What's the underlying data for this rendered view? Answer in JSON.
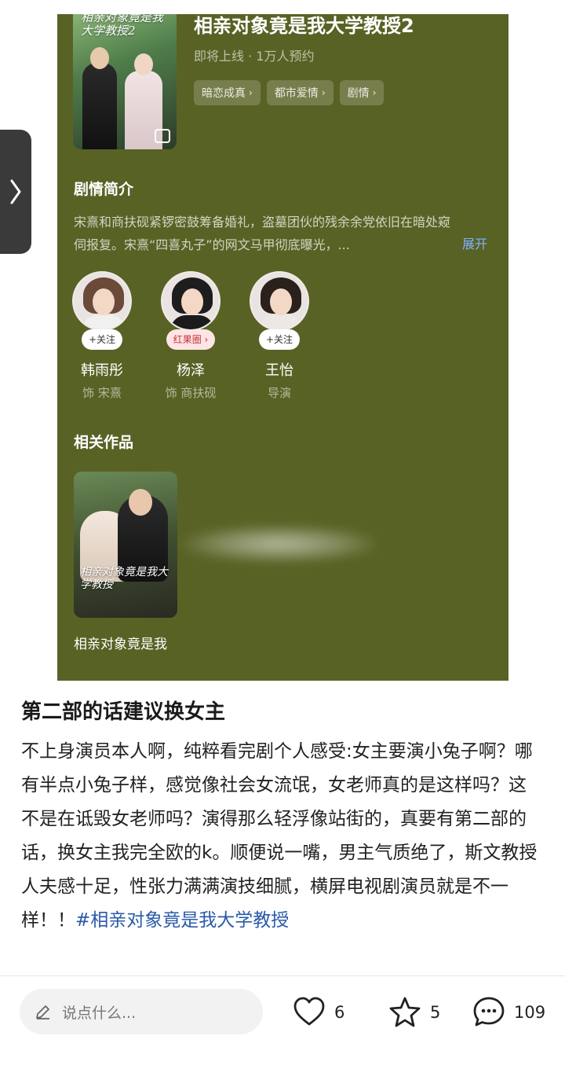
{
  "embedded_card": {
    "drama_title": "相亲对象竟是我大学教授2",
    "status": "即将上线 · 1万人预约",
    "tags": [
      "暗恋成真",
      "都市爱情",
      "剧情"
    ],
    "synopsis_heading": "剧情简介",
    "synopsis": "宋熹和商扶砚紧锣密鼓筹备婚礼，盗墓团伙的残余余党依旧在暗处窥伺报复。宋熹“四喜丸子”的网文马甲彻底曝光，...",
    "expand_label": "展开",
    "poster_title_art": "相亲对象竟是我大学教授2",
    "cast": [
      {
        "name": "韩雨彤",
        "role": "饰 宋熹",
        "pill": "+关注"
      },
      {
        "name": "杨泽",
        "role": "饰 商扶砚",
        "pill": "红果圈 ›"
      },
      {
        "name": "王怡",
        "role": "导演",
        "pill": "+关注"
      }
    ],
    "related_heading": "相关作品",
    "related_title": "相亲对象竟是我",
    "related_poster_art": "相亲对象竟是我大学教授"
  },
  "post": {
    "title": "第二部的话建议换女主",
    "body": "不上身演员本人啊，纯粹看完剧个人感受:女主要演小兔子啊？哪有半点小兔子样，感觉像社会女流氓，女老师真的是这样吗？这不是在诋毁女老师吗？演得那么轻浮像站街的，真要有第二部的话，换女主我完全欧的k。顺便说一嘴，男主气质绝了，斯文教授人夫感十足，性张力满满演技细腻，横屏电视剧演员就是不一样！！",
    "hashtag": "#相亲对象竟是我大学教授"
  },
  "bottom_bar": {
    "comment_placeholder": "说点什么...",
    "likes": "6",
    "favorites": "5",
    "comments": "109"
  },
  "icons": {
    "side_handle": "chevron-right-icon",
    "comment_input": "pencil-icon",
    "like": "heart-icon",
    "favorite": "star-icon",
    "comment": "chat-bubble-icon"
  },
  "colors": {
    "card_background": "#596225",
    "hashtag": "#2a5aa8",
    "expand_link": "#7fb0ff"
  }
}
